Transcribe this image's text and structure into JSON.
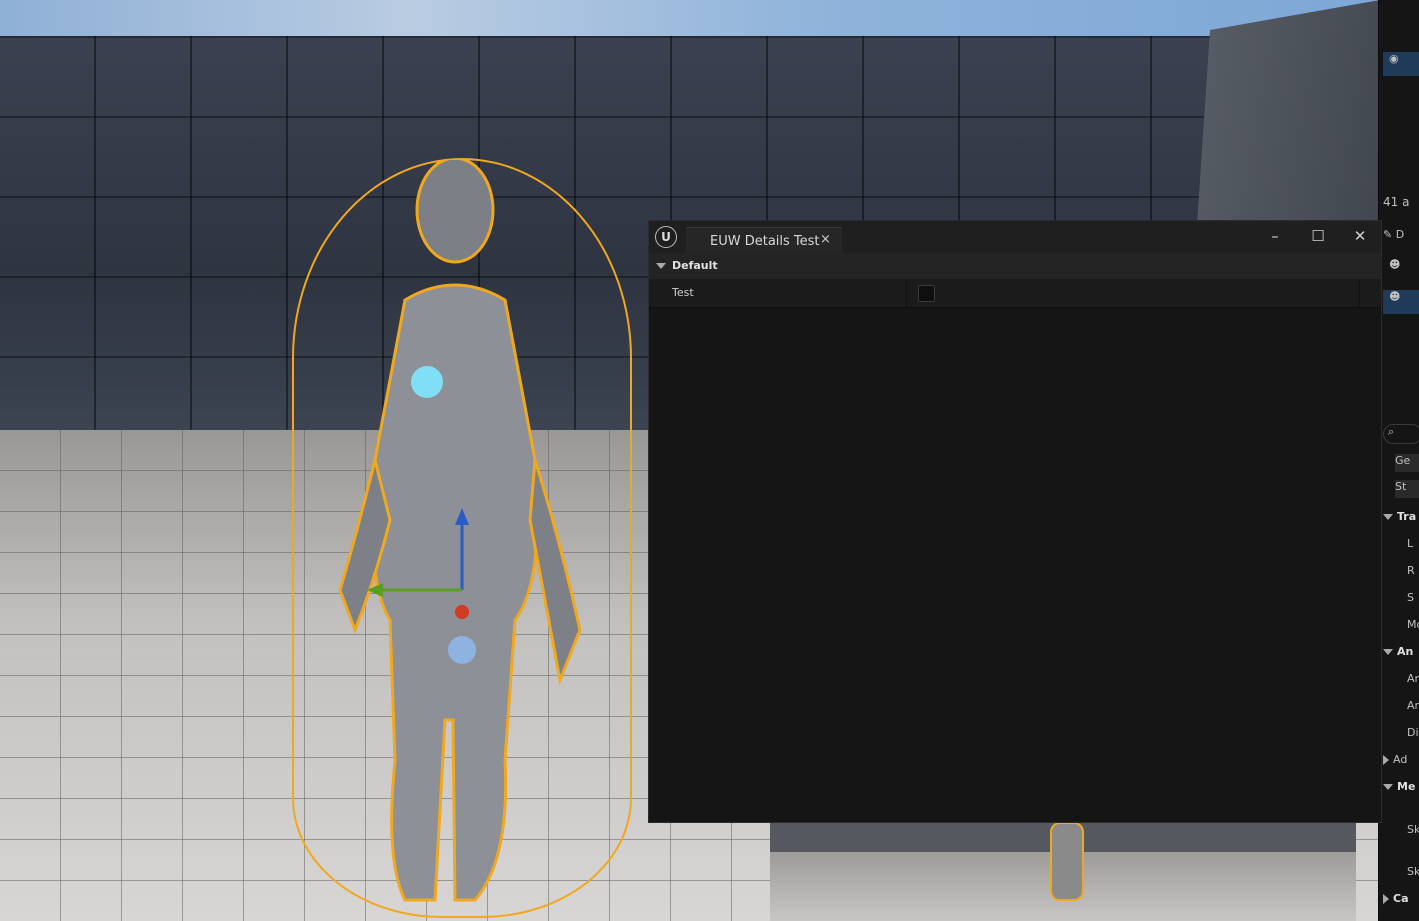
{
  "window": {
    "tab_title": "EUW Details Test",
    "tab_close": "×",
    "minimize": "–",
    "maximize": "☐",
    "close": "✕",
    "logo": "U"
  },
  "details": {
    "category": "Default",
    "properties": [
      {
        "name": "Test",
        "checked": false
      }
    ]
  },
  "side_panel": {
    "actor_count": "41 a",
    "details_label": "D",
    "search_icon": "search-icon",
    "buttons": [
      "Ge",
      "St"
    ],
    "sections": [
      "Tra",
      "An",
      "Me",
      "Ca"
    ],
    "rows": [
      "L",
      "R",
      "S",
      "Mo",
      "An",
      "An",
      "Dis",
      "Ad",
      "Sk",
      "Sk"
    ]
  },
  "colors": {
    "selection_outline": "#f0a81e",
    "panel_bg": "#151515",
    "selection_blue": "#203a5a"
  }
}
